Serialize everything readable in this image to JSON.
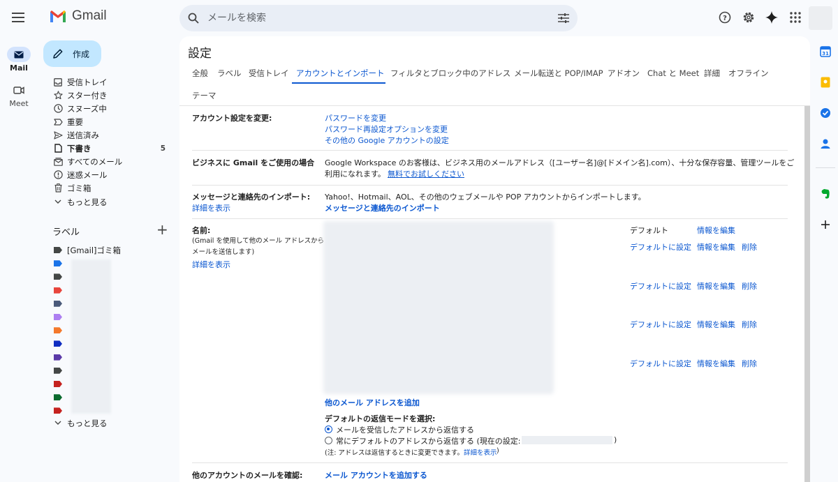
{
  "app": {
    "name": "Gmail"
  },
  "search": {
    "placeholder": "メールを検索"
  },
  "rail": {
    "mail_label": "Mail",
    "meet_label": "Meet"
  },
  "compose": {
    "label": "作成"
  },
  "nav": {
    "items": [
      {
        "label": "受信トレイ",
        "icon": "inbox-icon"
      },
      {
        "label": "スター付き",
        "icon": "star-icon"
      },
      {
        "label": "スヌーズ中",
        "icon": "clock-icon"
      },
      {
        "label": "重要",
        "icon": "important-icon"
      },
      {
        "label": "送信済み",
        "icon": "send-icon"
      },
      {
        "label": "下書き",
        "icon": "draft-icon",
        "count": "5",
        "bold": true
      },
      {
        "label": "すべてのメール",
        "icon": "all-mail-icon"
      },
      {
        "label": "迷惑メール",
        "icon": "spam-icon"
      },
      {
        "label": "ゴミ箱",
        "icon": "trash-icon"
      },
      {
        "label": "もっと見る",
        "icon": "chevron-down-icon"
      }
    ]
  },
  "labels": {
    "heading": "ラベル",
    "first_label": "[Gmail]ゴミ箱",
    "more": "もっと見る",
    "colors": [
      "#444746",
      "#1a73e8",
      "#444746",
      "#e8453c",
      "#4a5a7a",
      "#ad7ff1",
      "#f4792c",
      "#0f2dc1",
      "#5b3aa8",
      "#444746",
      "#c5221f",
      "#0b6b2f",
      "#c5221f"
    ]
  },
  "settings": {
    "title": "設定",
    "tabs": [
      "全般",
      "ラベル",
      "受信トレイ",
      "アカウントとインポート",
      "フィルタとブロック中のアドレス",
      "メール転送と POP/IMAP",
      "アドオン",
      "Chat と Meet",
      "詳細",
      "オフライン",
      "テーマ"
    ],
    "active_tab": "アカウントとインポート",
    "change_account": {
      "label": "アカウント設定を変更:",
      "links": [
        "パスワードを変更",
        "パスワード再設定オプションを変更",
        "その他の Google アカウントの設定"
      ]
    },
    "business": {
      "label": "ビジネスに Gmail をご使用の場合",
      "text1": "Google Workspace のお客様は、ビジネス用のメールアドレス（[ユーザー名]@[ドメイン名].com）、十分な保存容量、管理ツールをご",
      "text2": "利用になれます。",
      "link": "無料でお試しください"
    },
    "import": {
      "label": "メッセージと連絡先のインポート:",
      "detail_link": "詳細を表示",
      "text": "Yahoo!、Hotmail、AOL、その他のウェブメールや POP アカウントからインポートします。",
      "link": "メッセージと連絡先のインポート"
    },
    "name": {
      "label": "名前:",
      "desc1": "(Gmail を使用して他のメール アドレスから",
      "desc2": "メールを送信します)",
      "detail_link": "詳細を表示",
      "default_text": "デフォルト",
      "edit_info": "情報を編集",
      "set_default": "デフォルトに設定",
      "delete": "削除",
      "add_address": "他のメール アドレスを追加",
      "reply_mode_title": "デフォルトの返信モードを選択:",
      "reply_option1": "メールを受信したアドレスから返信する",
      "reply_option2": "常にデフォルトのアドレスから返信する (現在の設定:",
      "reply_option2_close": ")",
      "note": "(注: アドレスは返信するときに変更できます。",
      "note_link": "詳細を表示",
      "note_close": ")",
      "selected_option": 1
    },
    "check_mail": {
      "label": "他のアカウントのメールを確認:",
      "link": "メール アカウントを追加する"
    }
  },
  "colors": {
    "accent": "#0b57d0",
    "compose_bg": "#c2e7ff",
    "background": "#f8fafd"
  }
}
